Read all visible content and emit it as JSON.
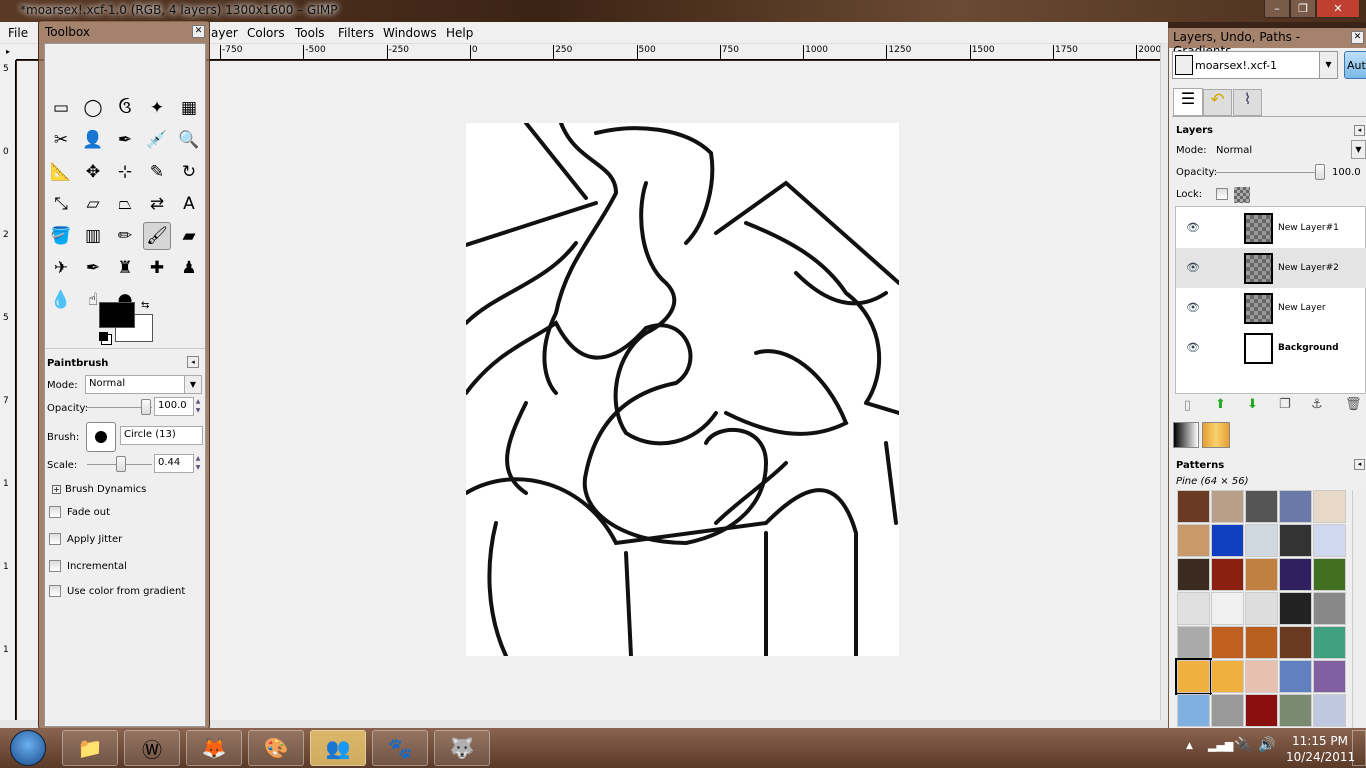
{
  "window": {
    "title": "*moarsex!.xcf-1.0 (RGB, 4 layers) 1300x1600 – GIMP",
    "minimize": "–",
    "maximize": "❐",
    "close": "✕"
  },
  "menu": [
    "File",
    "Layer",
    "Colors",
    "Tools",
    "Filters",
    "Windows",
    "Help"
  ],
  "menu_visible": {
    "file": "File",
    "layer": "ayer",
    "colors": "Colors",
    "tools": "Tools",
    "filters": "Filters",
    "windows": "Windows",
    "help": "Help"
  },
  "hruler": [
    "-750",
    "-500",
    "-250",
    "0",
    "250",
    "500",
    "750",
    "1000",
    "1250",
    "1500",
    "1750",
    "2000"
  ],
  "vruler": [
    "5",
    "0",
    "2",
    "5",
    "7",
    "1",
    "1",
    "1"
  ],
  "toolbox": {
    "title": "Toolbox",
    "tools": [
      "rect-select",
      "ellipse-select",
      "free-select",
      "fuzzy-select",
      "color-select",
      "scissors-select",
      "foreground-select",
      "paths",
      "color-picker",
      "zoom",
      "measure",
      "move",
      "align",
      "crop",
      "rotate",
      "scale",
      "shear",
      "perspective",
      "flip",
      "text",
      "bucket-fill",
      "blend",
      "pencil",
      "paintbrush",
      "eraser",
      "airbrush",
      "ink",
      "clone",
      "heal",
      "perspective-clone",
      "blur",
      "smudge",
      "dodge-burn"
    ],
    "active_tool": "paintbrush",
    "fg_color": "#000000",
    "bg_color": "#ffffff",
    "options": {
      "title": "Paintbrush",
      "mode_label": "Mode:",
      "mode": "Normal",
      "opacity_label": "Opacity:",
      "opacity": "100.0",
      "opacity_value": 1.0,
      "brush_label": "Brush:",
      "brush": "Circle (13)",
      "scale_label": "Scale:",
      "scale": "0.44",
      "scale_value": 0.44,
      "dynamics": "Brush Dynamics",
      "checks": [
        "Fade out",
        "Apply Jitter",
        "Incremental",
        "Use color from gradient"
      ]
    }
  },
  "dock": {
    "title": "Layers, Undo, Paths - Gradients, ...",
    "image": "moarsex!.xcf-1",
    "auto": "Auto",
    "layers_title": "Layers",
    "mode_label": "Mode:",
    "mode": "Normal",
    "opacity_label": "Opacity:",
    "opacity": "100.0",
    "lock_label": "Lock:",
    "layers": [
      {
        "name": "New Layer#1",
        "selected": false
      },
      {
        "name": "New Layer#2",
        "selected": true
      },
      {
        "name": "New Layer",
        "selected": false
      },
      {
        "name": "Background",
        "selected": false
      }
    ],
    "patterns_title": "Patterns",
    "pattern_name": "Pine (64 × 56)",
    "pattern_colors": [
      "#6b3a22",
      "#b8a088",
      "#555",
      "#6a7aa8",
      "#e8d8c8",
      "#c89a6a",
      "#1040c0",
      "#d0d8e0",
      "#333",
      "#d0d8f0",
      "#3a2a20",
      "#8a2010",
      "#c08040",
      "#302060",
      "#407020",
      "#e0e0e0",
      "#f0f0f0",
      "#ddd",
      "#222",
      "#888",
      "#aaa",
      "#c06020",
      "#b86020",
      "#6a3a20",
      "#40a080",
      "#f0b040",
      "#f0b040",
      "#e8c0b0",
      "#6080c0",
      "#8060a0",
      "#80b0e0",
      "#999",
      "#8a1010",
      "#7a8a70",
      "#c0c8e0",
      "#666",
      "#c08070",
      "#203060",
      "#a0a0b0",
      "#222"
    ]
  },
  "taskbar": {
    "apps": [
      "explorer",
      "warcraft",
      "firefox",
      "paint",
      "messenger",
      "paw",
      "gimp"
    ],
    "time": "11:15 PM",
    "date": "10/24/2011"
  }
}
